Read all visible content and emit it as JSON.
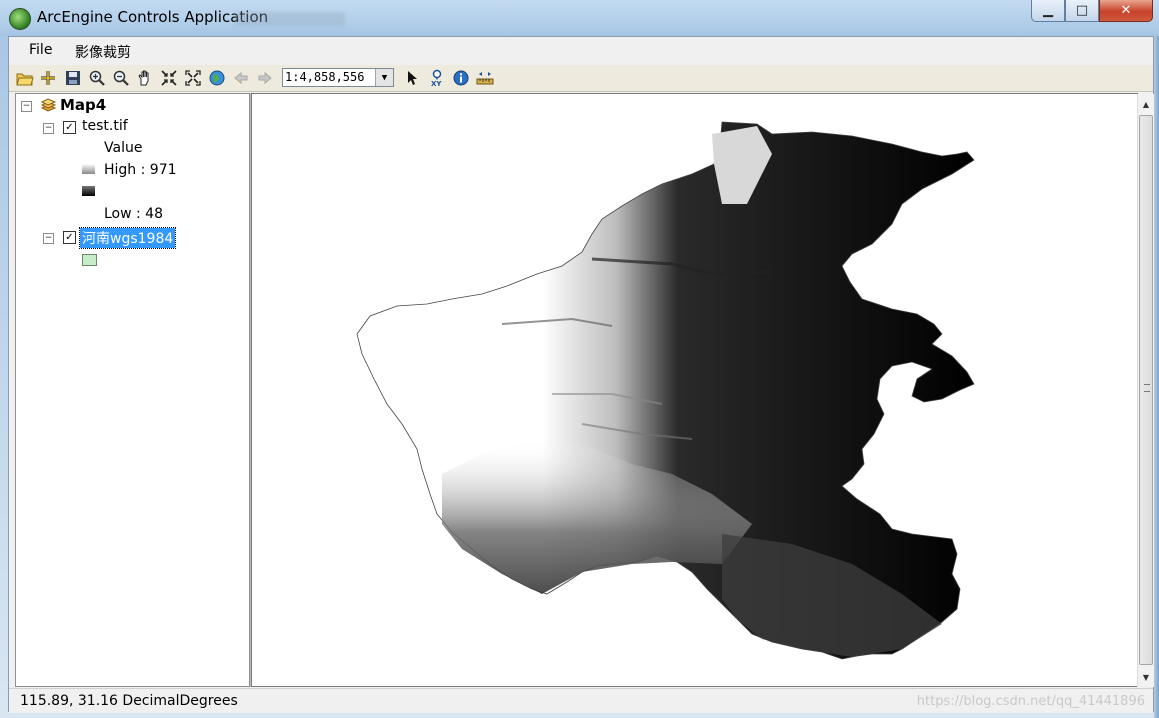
{
  "window": {
    "title": "ArcEngine Controls Application",
    "controls": {
      "minimize": "▁",
      "maximize": "□",
      "close": "✕"
    }
  },
  "menu": {
    "file": "File",
    "image_clip": "影像裁剪"
  },
  "toolbar": {
    "scale": "1:4,858,556",
    "icons": [
      "open-icon",
      "add-data-icon",
      "save-icon",
      "zoom-in-icon",
      "zoom-out-icon",
      "pan-icon",
      "fixed-zoom-in-icon",
      "fixed-zoom-out-icon",
      "full-extent-icon",
      "back-icon",
      "forward-icon",
      "select-icon",
      "go-to-xy-icon",
      "identify-icon",
      "measure-icon"
    ]
  },
  "toc": {
    "map_name": "Map4",
    "layers": [
      {
        "name": "test.tif",
        "legend": {
          "heading": "Value",
          "high": "High : 971",
          "low": "Low : 48"
        }
      },
      {
        "name": "河南wgs1984",
        "selected": true,
        "swatch_color": "#c8ecc8"
      }
    ]
  },
  "status": {
    "coords": "115.89, 31.16  DecimalDegrees",
    "watermark": "https://blog.csdn.net/qq_41441896"
  },
  "colors": {
    "selection": "#3399ff",
    "title_bar": "#a6c5e4"
  }
}
